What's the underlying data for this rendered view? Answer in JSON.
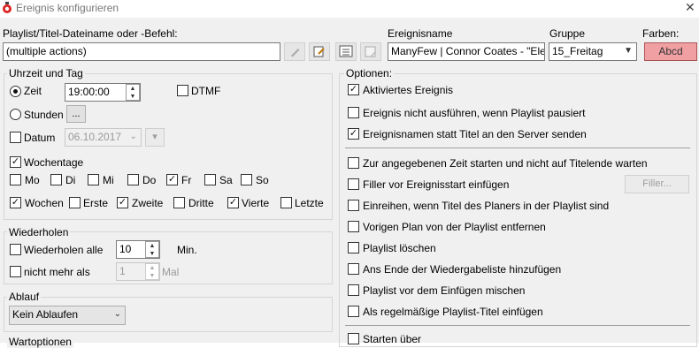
{
  "window": {
    "title": "Ereignis konfigurieren",
    "close_glyph": "✕"
  },
  "top": {
    "file_label": "Playlist/Titel-Dateiname oder -Befehl:",
    "file_value": "(multiple actions)",
    "name_label": "Ereignisname",
    "name_value": "ManyFew | Connor Coates - \"Elec",
    "group_label": "Gruppe",
    "group_value": "15_Freitag",
    "colors_label": "Farben:",
    "color_button": "Abcd",
    "color_bg": "#f0a0a3"
  },
  "time": {
    "group_title": "Uhrzeit und Tag",
    "zeit_label": "Zeit",
    "zeit_value": "19:00:00",
    "dtmf_label": "DTMF",
    "stunden_label": "Stunden",
    "stunden_button": "...",
    "datum_label": "Datum",
    "datum_value": "06.10.2017",
    "wochentage_label": "Wochentage",
    "days": [
      "Mo",
      "Di",
      "Mi",
      "Do",
      "Fr",
      "Sa",
      "So"
    ],
    "weeks_label": "Wochen",
    "weeks": [
      "Erste",
      "Zweite",
      "Dritte",
      "Vierte",
      "Letzte"
    ]
  },
  "repeat": {
    "group_title": "Wiederholen",
    "every_label": "Wiederholen alle",
    "every_value": "10",
    "every_unit": "Min.",
    "max_label": "nicht mehr als",
    "max_value": "1",
    "max_unit": "Mal"
  },
  "expiry": {
    "group_title": "Ablauf",
    "value": "Kein Ablaufen"
  },
  "wait_options_title": "Wartoptionen",
  "options": {
    "group_title": "Optionen:",
    "items": [
      "Aktiviertes Ereignis",
      "Ereignis nicht ausführen, wenn Playlist pausiert",
      "Ereignisnamen statt Titel an den Server senden",
      "Zur angegebenen Zeit starten und nicht auf Titelende warten",
      "Filler vor Ereignisstart einfügen",
      "Einreihen, wenn Titel des Planers in der Playlist sind",
      "Vorigen Plan von der Playlist entfernen",
      "Playlist löschen",
      "Ans Ende der Wiedergabeliste hinzufügen",
      "Playlist vor dem Einfügen mischen",
      "Als regelmäßige Playlist-Titel einfügen",
      "Starten über"
    ],
    "filler_button": "Filler..."
  }
}
